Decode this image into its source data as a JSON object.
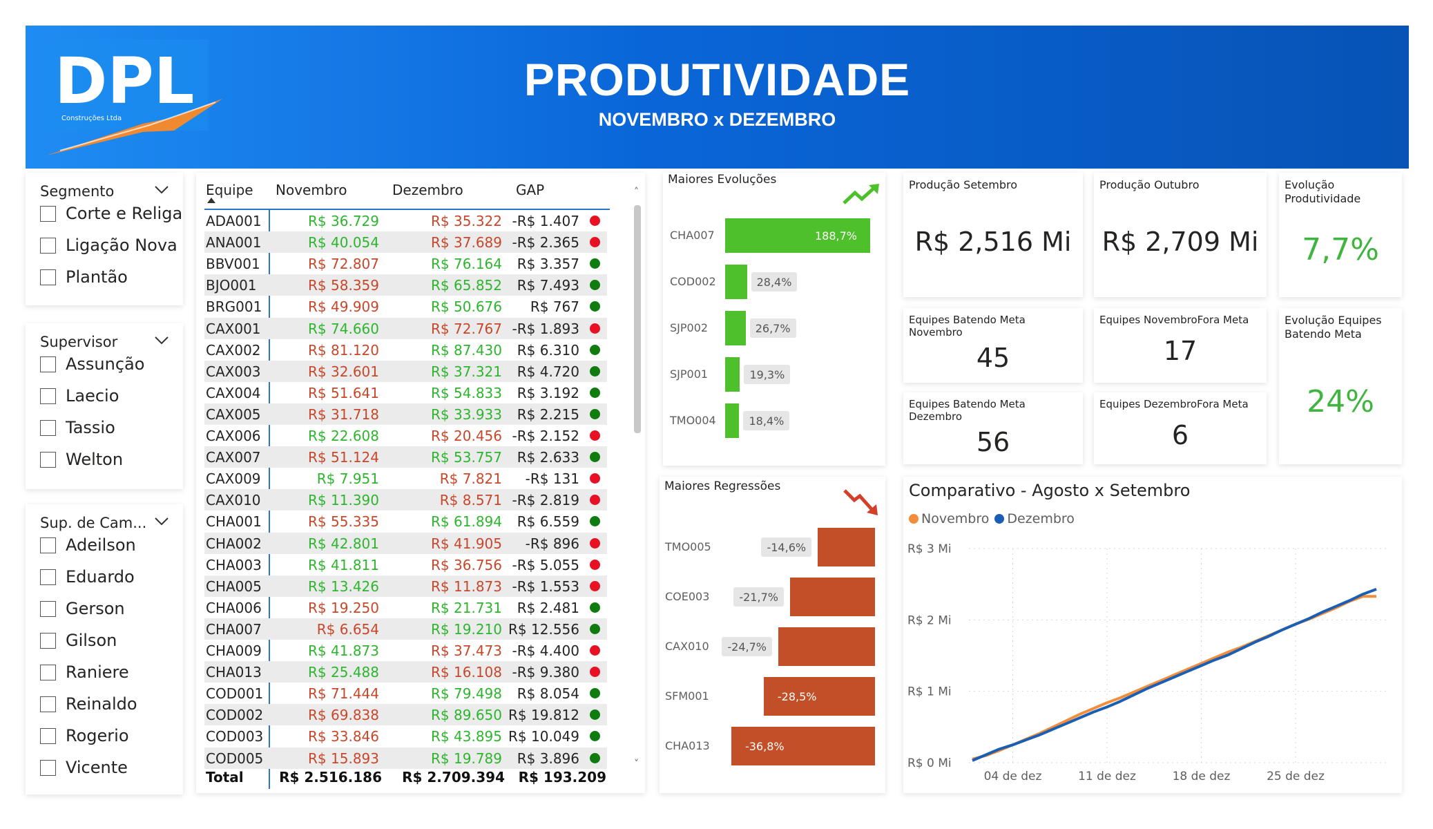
{
  "header": {
    "logo_text": "DPL",
    "logo_subtext": "Construções Ltda",
    "title": "PRODUTIVIDADE",
    "subtitle": "NOVEMBRO x DEZEMBRO"
  },
  "slicers": [
    {
      "title": "Segmento",
      "items": [
        "Corte e Religa",
        "Ligação Nova",
        "Plantão"
      ]
    },
    {
      "title": "Supervisor",
      "items": [
        "Assunção",
        "Laecio",
        "Tassio",
        "Welton"
      ]
    },
    {
      "title": "Sup. de Cam...",
      "items": [
        "Adeilson",
        "Eduardo",
        "Gerson",
        "Gilson",
        "Raniere",
        "Reinaldo",
        "Rogerio",
        "Vicente"
      ]
    }
  ],
  "table": {
    "headers": [
      "Equipe",
      "Novembro",
      "Dezembro",
      "GAP"
    ],
    "rows": [
      {
        "eq": "ADA001",
        "nov": "R$ 36.729",
        "nov_c": "green",
        "dez": "R$ 35.322",
        "dez_c": "red",
        "gap": "-R$ 1.407",
        "dot": "#e81123"
      },
      {
        "eq": "ANA001",
        "nov": "R$ 40.054",
        "nov_c": "green",
        "dez": "R$ 37.689",
        "dez_c": "red",
        "gap": "-R$ 2.365",
        "dot": "#e81123"
      },
      {
        "eq": "BBV001",
        "nov": "R$ 72.807",
        "nov_c": "red",
        "dez": "R$ 76.164",
        "dez_c": "green",
        "gap": "R$ 3.357",
        "dot": "#107c10"
      },
      {
        "eq": "BJO001",
        "nov": "R$ 58.359",
        "nov_c": "red",
        "dez": "R$ 65.852",
        "dez_c": "green",
        "gap": "R$ 7.493",
        "dot": "#107c10"
      },
      {
        "eq": "BRG001",
        "nov": "R$ 49.909",
        "nov_c": "red",
        "dez": "R$ 50.676",
        "dez_c": "green",
        "gap": "R$ 767",
        "dot": "#107c10"
      },
      {
        "eq": "CAX001",
        "nov": "R$ 74.660",
        "nov_c": "green",
        "dez": "R$ 72.767",
        "dez_c": "red",
        "gap": "-R$ 1.893",
        "dot": "#e81123"
      },
      {
        "eq": "CAX002",
        "nov": "R$ 81.120",
        "nov_c": "red",
        "dez": "R$ 87.430",
        "dez_c": "green",
        "gap": "R$ 6.310",
        "dot": "#107c10"
      },
      {
        "eq": "CAX003",
        "nov": "R$ 32.601",
        "nov_c": "red",
        "dez": "R$ 37.321",
        "dez_c": "green",
        "gap": "R$ 4.720",
        "dot": "#107c10"
      },
      {
        "eq": "CAX004",
        "nov": "R$ 51.641",
        "nov_c": "red",
        "dez": "R$ 54.833",
        "dez_c": "green",
        "gap": "R$ 3.192",
        "dot": "#107c10"
      },
      {
        "eq": "CAX005",
        "nov": "R$ 31.718",
        "nov_c": "red",
        "dez": "R$ 33.933",
        "dez_c": "green",
        "gap": "R$ 2.215",
        "dot": "#107c10"
      },
      {
        "eq": "CAX006",
        "nov": "R$ 22.608",
        "nov_c": "green",
        "dez": "R$ 20.456",
        "dez_c": "red",
        "gap": "-R$ 2.152",
        "dot": "#e81123"
      },
      {
        "eq": "CAX007",
        "nov": "R$ 51.124",
        "nov_c": "red",
        "dez": "R$ 53.757",
        "dez_c": "green",
        "gap": "R$ 2.633",
        "dot": "#107c10"
      },
      {
        "eq": "CAX009",
        "nov": "R$ 7.951",
        "nov_c": "green",
        "dez": "R$ 7.821",
        "dez_c": "red",
        "gap": "-R$ 131",
        "dot": "#e81123"
      },
      {
        "eq": "CAX010",
        "nov": "R$ 11.390",
        "nov_c": "green",
        "dez": "R$ 8.571",
        "dez_c": "red",
        "gap": "-R$ 2.819",
        "dot": "#e81123"
      },
      {
        "eq": "CHA001",
        "nov": "R$ 55.335",
        "nov_c": "red",
        "dez": "R$ 61.894",
        "dez_c": "green",
        "gap": "R$ 6.559",
        "dot": "#107c10"
      },
      {
        "eq": "CHA002",
        "nov": "R$ 42.801",
        "nov_c": "green",
        "dez": "R$ 41.905",
        "dez_c": "red",
        "gap": "-R$ 896",
        "dot": "#e81123"
      },
      {
        "eq": "CHA003",
        "nov": "R$ 41.811",
        "nov_c": "green",
        "dez": "R$ 36.756",
        "dez_c": "red",
        "gap": "-R$ 5.055",
        "dot": "#e81123"
      },
      {
        "eq": "CHA005",
        "nov": "R$ 13.426",
        "nov_c": "green",
        "dez": "R$ 11.873",
        "dez_c": "red",
        "gap": "-R$ 1.553",
        "dot": "#e81123"
      },
      {
        "eq": "CHA006",
        "nov": "R$ 19.250",
        "nov_c": "red",
        "dez": "R$ 21.731",
        "dez_c": "green",
        "gap": "R$ 2.481",
        "dot": "#107c10"
      },
      {
        "eq": "CHA007",
        "nov": "R$ 6.654",
        "nov_c": "red",
        "dez": "R$ 19.210",
        "dez_c": "green",
        "gap": "R$ 12.556",
        "dot": "#107c10"
      },
      {
        "eq": "CHA009",
        "nov": "R$ 41.873",
        "nov_c": "green",
        "dez": "R$ 37.473",
        "dez_c": "red",
        "gap": "-R$ 4.400",
        "dot": "#e81123"
      },
      {
        "eq": "CHA013",
        "nov": "R$ 25.488",
        "nov_c": "green",
        "dez": "R$ 16.108",
        "dez_c": "red",
        "gap": "-R$ 9.380",
        "dot": "#e81123"
      },
      {
        "eq": "COD001",
        "nov": "R$ 71.444",
        "nov_c": "red",
        "dez": "R$ 79.498",
        "dez_c": "green",
        "gap": "R$ 8.054",
        "dot": "#107c10"
      },
      {
        "eq": "COD002",
        "nov": "R$ 69.838",
        "nov_c": "red",
        "dez": "R$ 89.650",
        "dez_c": "green",
        "gap": "R$ 19.812",
        "dot": "#107c10"
      },
      {
        "eq": "COD003",
        "nov": "R$ 33.846",
        "nov_c": "red",
        "dez": "R$ 43.895",
        "dez_c": "green",
        "gap": "R$ 10.049",
        "dot": "#107c10"
      },
      {
        "eq": "COD005",
        "nov": "R$ 15.893",
        "nov_c": "red",
        "dez": "R$ 19.789",
        "dez_c": "green",
        "gap": "R$ 3.896",
        "dot": "#107c10"
      }
    ],
    "total": {
      "label": "Total",
      "nov": "R$ 2.516.186",
      "dez": "R$ 2.709.394",
      "gap": "R$ 193.209"
    }
  },
  "evolucoes": {
    "title": "Maiores Evoluções",
    "icon": "trend-up-icon",
    "color": "#4dc02b",
    "items": [
      {
        "label": "CHA007",
        "value": 188.7,
        "text": "188,7%"
      },
      {
        "label": "COD002",
        "value": 28.4,
        "text": "28,4%"
      },
      {
        "label": "SJP002",
        "value": 26.7,
        "text": "26,7%"
      },
      {
        "label": "SJP001",
        "value": 19.3,
        "text": "19,3%"
      },
      {
        "label": "TMO004",
        "value": 18.4,
        "text": "18,4%"
      }
    ]
  },
  "regressoes": {
    "title": "Maiores Regressões",
    "icon": "trend-down-icon",
    "color": "#c24f27",
    "items": [
      {
        "label": "TMO005",
        "value": -14.6,
        "text": "-14,6%"
      },
      {
        "label": "COE003",
        "value": -21.7,
        "text": "-21,7%"
      },
      {
        "label": "CAX010",
        "value": -24.7,
        "text": "-24,7%"
      },
      {
        "label": "SFM001",
        "value": -28.5,
        "text": "-28,5%"
      },
      {
        "label": "CHA013",
        "value": -36.8,
        "text": "-36,8%"
      }
    ]
  },
  "kpis": {
    "prod_set": {
      "title": "Produção Setembro",
      "value": "R$ 2,516 Mi"
    },
    "prod_out": {
      "title": "Produção Outubro",
      "value": "R$ 2,709 Mi"
    },
    "evol_prod": {
      "title": "Evolução Produtividade",
      "value": "7,7%"
    },
    "meta_nov": {
      "title": "Equipes Batendo Meta Novembro",
      "value": "45"
    },
    "fora_nov": {
      "title": "Equipes NovembroFora Meta",
      "value": "17"
    },
    "evol_meta": {
      "title": "Evolução Equipes Batendo Meta",
      "value": "24%"
    },
    "meta_dez": {
      "title": "Equipes Batendo Meta Dezembro",
      "value": "56"
    },
    "fora_dez": {
      "title": "Equipes DezembroFora Meta",
      "value": "6"
    }
  },
  "chart_data": {
    "type": "line",
    "title": "Comparativo - Agosto x Setembro",
    "legend_position": "top-left",
    "grid": true,
    "x_ticks": [
      "04 de dez",
      "11 de dez",
      "18 de dez",
      "25 de dez"
    ],
    "y_ticks": [
      "R$ 0 Mi",
      "R$ 1 Mi",
      "R$ 2 Mi",
      "R$ 3 Mi"
    ],
    "ylim": [
      0,
      3
    ],
    "x": [
      1,
      2,
      3,
      4,
      5,
      6,
      7,
      8,
      9,
      10,
      11,
      12,
      13,
      14,
      15,
      16,
      17,
      18,
      19,
      20,
      21,
      22,
      23,
      24,
      25,
      26,
      27,
      28,
      29,
      30,
      31
    ],
    "series": [
      {
        "name": "Novembro",
        "color": "#f28e3b",
        "values": [
          0.05,
          0.1,
          0.17,
          0.25,
          0.33,
          0.41,
          0.5,
          0.59,
          0.68,
          0.76,
          0.84,
          0.91,
          0.99,
          1.07,
          1.15,
          1.23,
          1.31,
          1.39,
          1.47,
          1.55,
          1.62,
          1.7,
          1.78,
          1.86,
          1.94,
          2.01,
          2.09,
          2.17,
          2.26,
          2.33,
          2.33
        ]
      },
      {
        "name": "Dezembro",
        "color": "#1a5fb4",
        "values": [
          0.03,
          0.11,
          0.19,
          0.25,
          0.32,
          0.39,
          0.47,
          0.55,
          0.63,
          0.71,
          0.78,
          0.86,
          0.95,
          1.04,
          1.12,
          1.2,
          1.28,
          1.36,
          1.44,
          1.51,
          1.6,
          1.69,
          1.77,
          1.86,
          1.94,
          2.02,
          2.11,
          2.19,
          2.27,
          2.36,
          2.43
        ]
      }
    ]
  }
}
